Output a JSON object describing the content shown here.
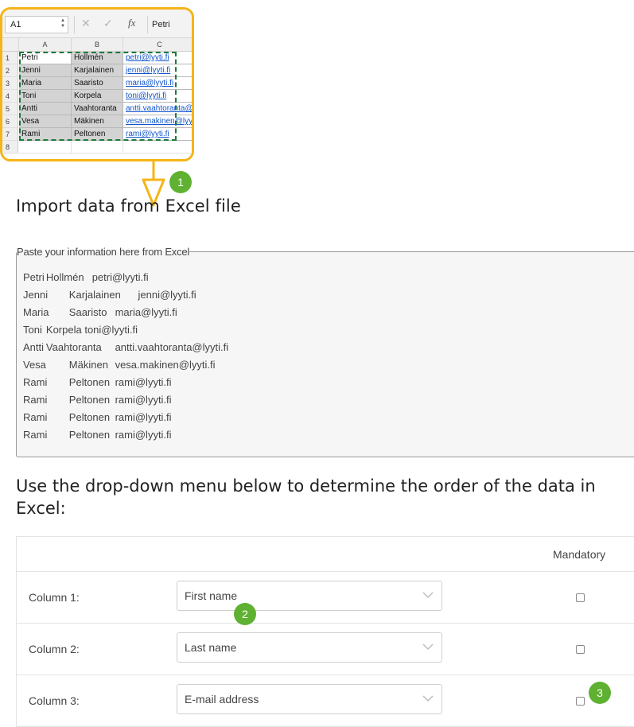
{
  "excel": {
    "name_box": "A1",
    "fx_label": "fx",
    "formula_value": "Petri",
    "column_headers": [
      "A",
      "B",
      "C"
    ],
    "row_numbers": [
      "1",
      "2",
      "3",
      "4",
      "5",
      "6",
      "7",
      "8"
    ],
    "rows": [
      [
        "Petri",
        "Hollmén",
        "petri@lyyti.fi"
      ],
      [
        "Jenni",
        "Karjalainen",
        "jenni@lyyti.fi"
      ],
      [
        "Maria",
        "Saaristo",
        "maria@lyyti.fi"
      ],
      [
        "Toni",
        "Korpela",
        "toni@lyyti.fi"
      ],
      [
        "Antti",
        "Vaahtoranta",
        "antti.vaahtoranta@lyyti.fi"
      ],
      [
        "Vesa",
        "Mäkinen",
        "vesa.makinen@lyyti.fi"
      ],
      [
        "Rami",
        "Peltonen",
        "rami@lyyti.fi"
      ]
    ],
    "highlight_color": "#f5b418",
    "selection_color": "#1d7a3a"
  },
  "badges": [
    "1",
    "2",
    "3"
  ],
  "badge_color": "#5fb131",
  "import_title": "Import data from Excel file",
  "paste": {
    "legend": "Paste your information here from Excel",
    "content": "Petri\tHollmén\tpetri@lyyti.fi\nJenni\tKarjalainen\tjenni@lyyti.fi\nMaria\tSaaristo\tmaria@lyyti.fi\nToni\tKorpela toni@lyyti.fi\nAntti\tVaahtoranta\tantti.vaahtoranta@lyyti.fi\nVesa\tMäkinen\tvesa.makinen@lyyti.fi\nRami\tPeltonen\trami@lyyti.fi\nRami\tPeltonen\trami@lyyti.fi\nRami\tPeltonen\trami@lyyti.fi\nRami\tPeltonen\trami@lyyti.fi"
  },
  "order_title": "Use the drop-down menu below to determine the order of the data in Excel:",
  "mapping": {
    "mandatory_header": "Mandatory",
    "columns": [
      {
        "label": "Column 1:",
        "selected": "First name",
        "mandatory": false
      },
      {
        "label": "Column 2:",
        "selected": "Last name",
        "mandatory": false
      },
      {
        "label": "Column 3:",
        "selected": "E-mail address",
        "mandatory": false
      }
    ]
  }
}
